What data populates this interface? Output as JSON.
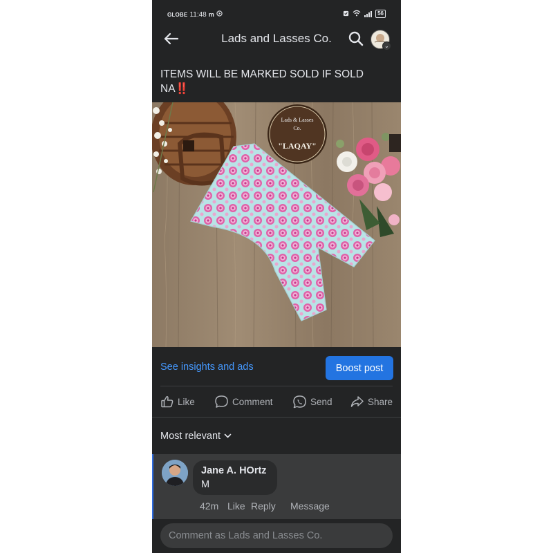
{
  "status_bar": {
    "carrier": "GLOBE",
    "time": "11:48",
    "battery": "56"
  },
  "header": {
    "title": "Lads and Lasses Co.",
    "back_icon": "arrow-left-icon",
    "search_icon": "search-icon",
    "profile_icon": "profile-avatar"
  },
  "post": {
    "text_line1": "ITEMS WILL BE MARKED SOLD IF SOLD",
    "text_line2": "NA",
    "emoji": "‼️",
    "logo_text": {
      "line1": "Lads & Lasses",
      "line2": "Co.",
      "line3": "\"LAQAY\""
    }
  },
  "insights": {
    "link": "See insights and ads",
    "boost_button": "Boost post"
  },
  "actions": {
    "like": "Like",
    "comment": "Comment",
    "send": "Send",
    "share": "Share"
  },
  "sort": {
    "label": "Most relevant"
  },
  "comment": {
    "author": "Jane A. HOrtz",
    "text": "M",
    "time": "42m",
    "like": "Like",
    "reply": "Reply",
    "message": "Message"
  },
  "composer": {
    "placeholder": "Comment as Lads and Lasses Co."
  },
  "colors": {
    "background": "#232425",
    "accent": "#2374e1",
    "link": "#4599ff"
  }
}
